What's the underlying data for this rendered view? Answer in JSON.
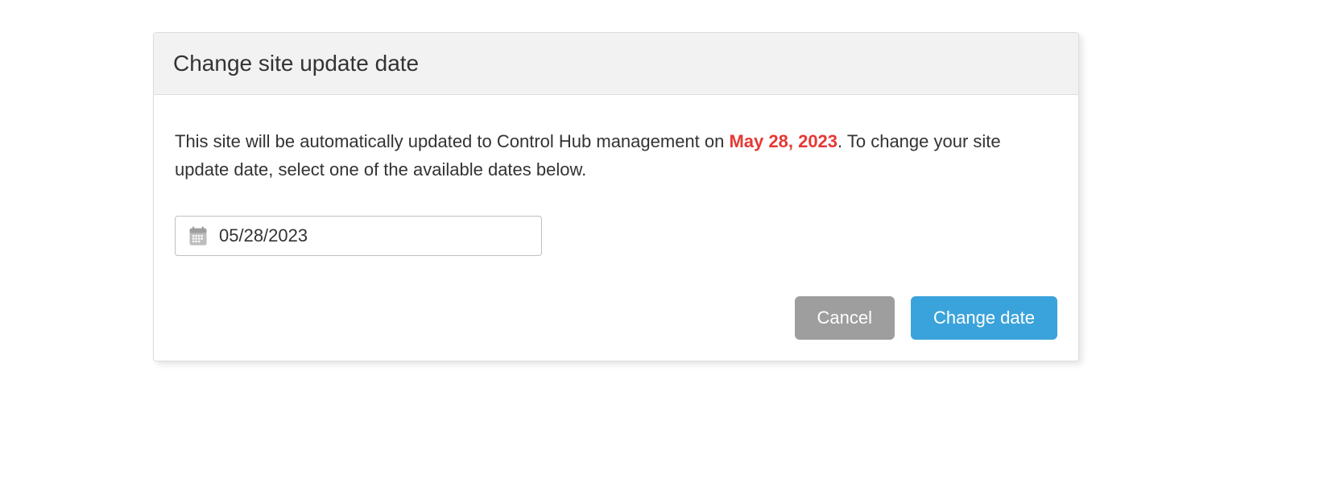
{
  "modal": {
    "title": "Change site update date",
    "description_prefix": "This site will be automatically updated to Control Hub management on ",
    "highlighted_date": "May 28, 2023",
    "description_suffix": ". To change your site update date, select one of the available dates below.",
    "date_value": "05/28/2023",
    "cancel_label": "Cancel",
    "change_label": "Change date"
  }
}
